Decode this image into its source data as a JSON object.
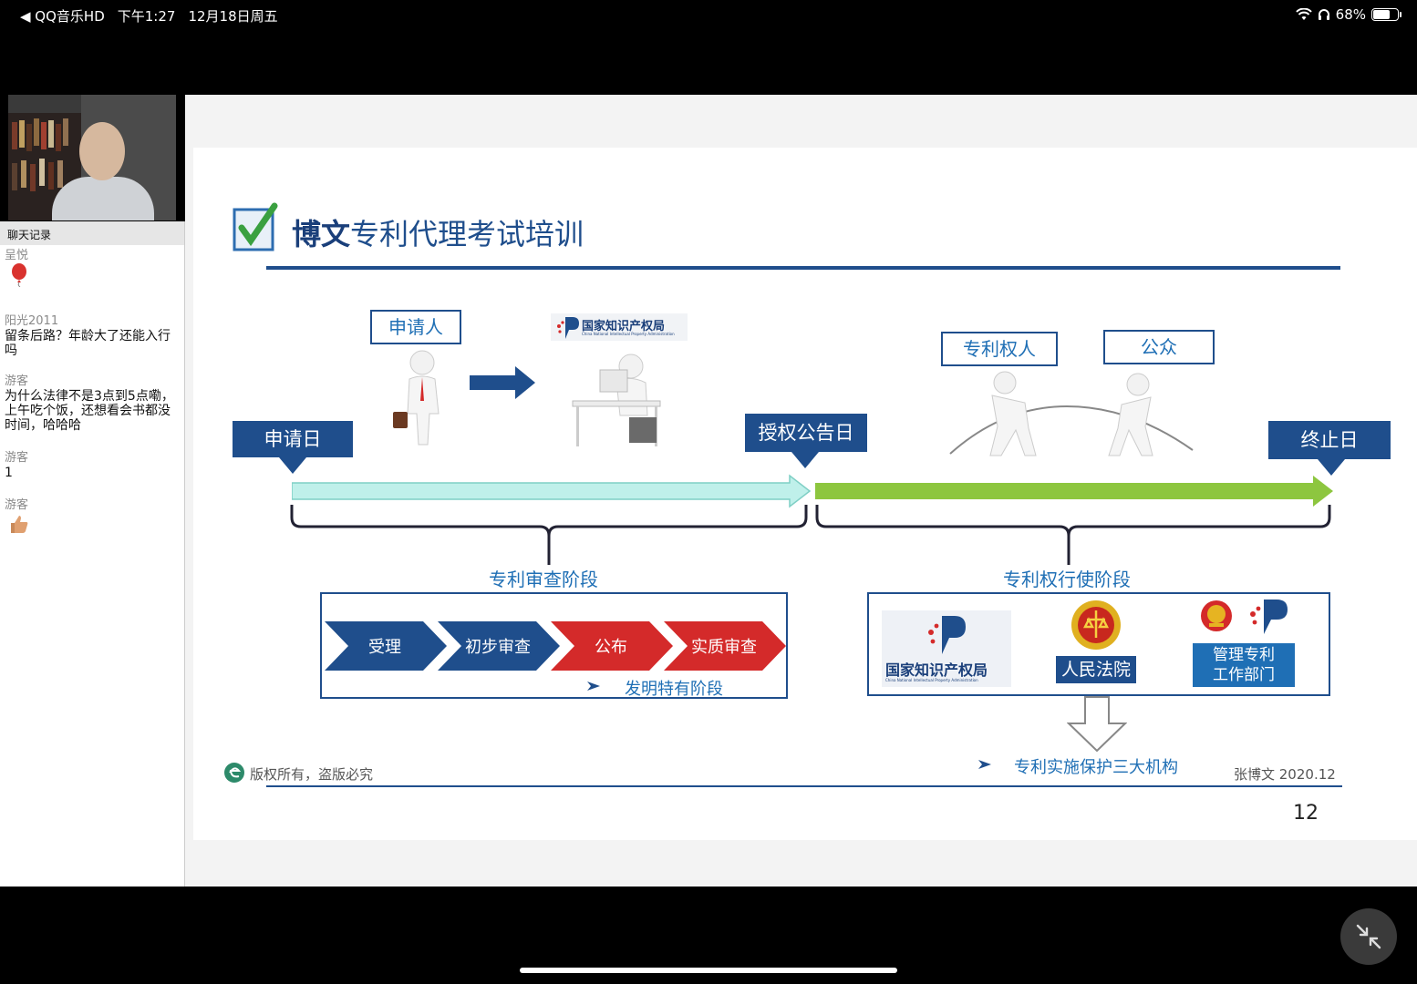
{
  "status_bar": {
    "back_app": "◀ QQ音乐HD",
    "time": "下午1:27",
    "date": "12月18日周五",
    "battery": "68%",
    "battery_level": 0.68
  },
  "chat": {
    "header": "聊天记录",
    "messages": [
      {
        "user": "呈悦",
        "text": "",
        "emoji": "balloon"
      },
      {
        "user": "阳光2011",
        "text": "留条后路？年龄大了还能入行吗"
      },
      {
        "user": "游客",
        "text": "为什么法律不是3点到5点嘞，上午吃个饭，还想看会书都没时间，哈哈哈"
      },
      {
        "user": "游客",
        "text": "1"
      },
      {
        "user": "游客",
        "text": "",
        "emoji": "thumbs-up"
      }
    ]
  },
  "slide": {
    "title_bold": "博文",
    "title_rest": "专利代理考试培训",
    "applicant": "申请人",
    "cnipa_logo_cn": "国家知识产权局",
    "cnipa_logo_en": "China National Intellectual Property Administration",
    "patentee": "专利权人",
    "public": "公众",
    "filing_date": "申请日",
    "grant_date": "授权公告日",
    "end_date": "终止日",
    "exam_phase": "专利审查阶段",
    "exercise_phase": "专利权行使阶段",
    "steps": [
      "受理",
      "初步审查",
      "公布",
      "实质审查"
    ],
    "invention_note": "发明特有阶段",
    "institution_1": "国家知识产权局",
    "institution_2": "人民法院",
    "institution_3_line1": "管理专利",
    "institution_3_line2": "工作部门",
    "three_orgs": "专利实施保护三大机构",
    "copyright": "版权所有，盗版必究",
    "author": "张博文 2020.12",
    "page": "12"
  },
  "colors": {
    "navy": "#1f4e8c",
    "light_blue": "#1f6fb5",
    "teal_arrow": "#bff0ea",
    "green_arrow": "#8dc63f",
    "red_step": "#d42a2a"
  }
}
